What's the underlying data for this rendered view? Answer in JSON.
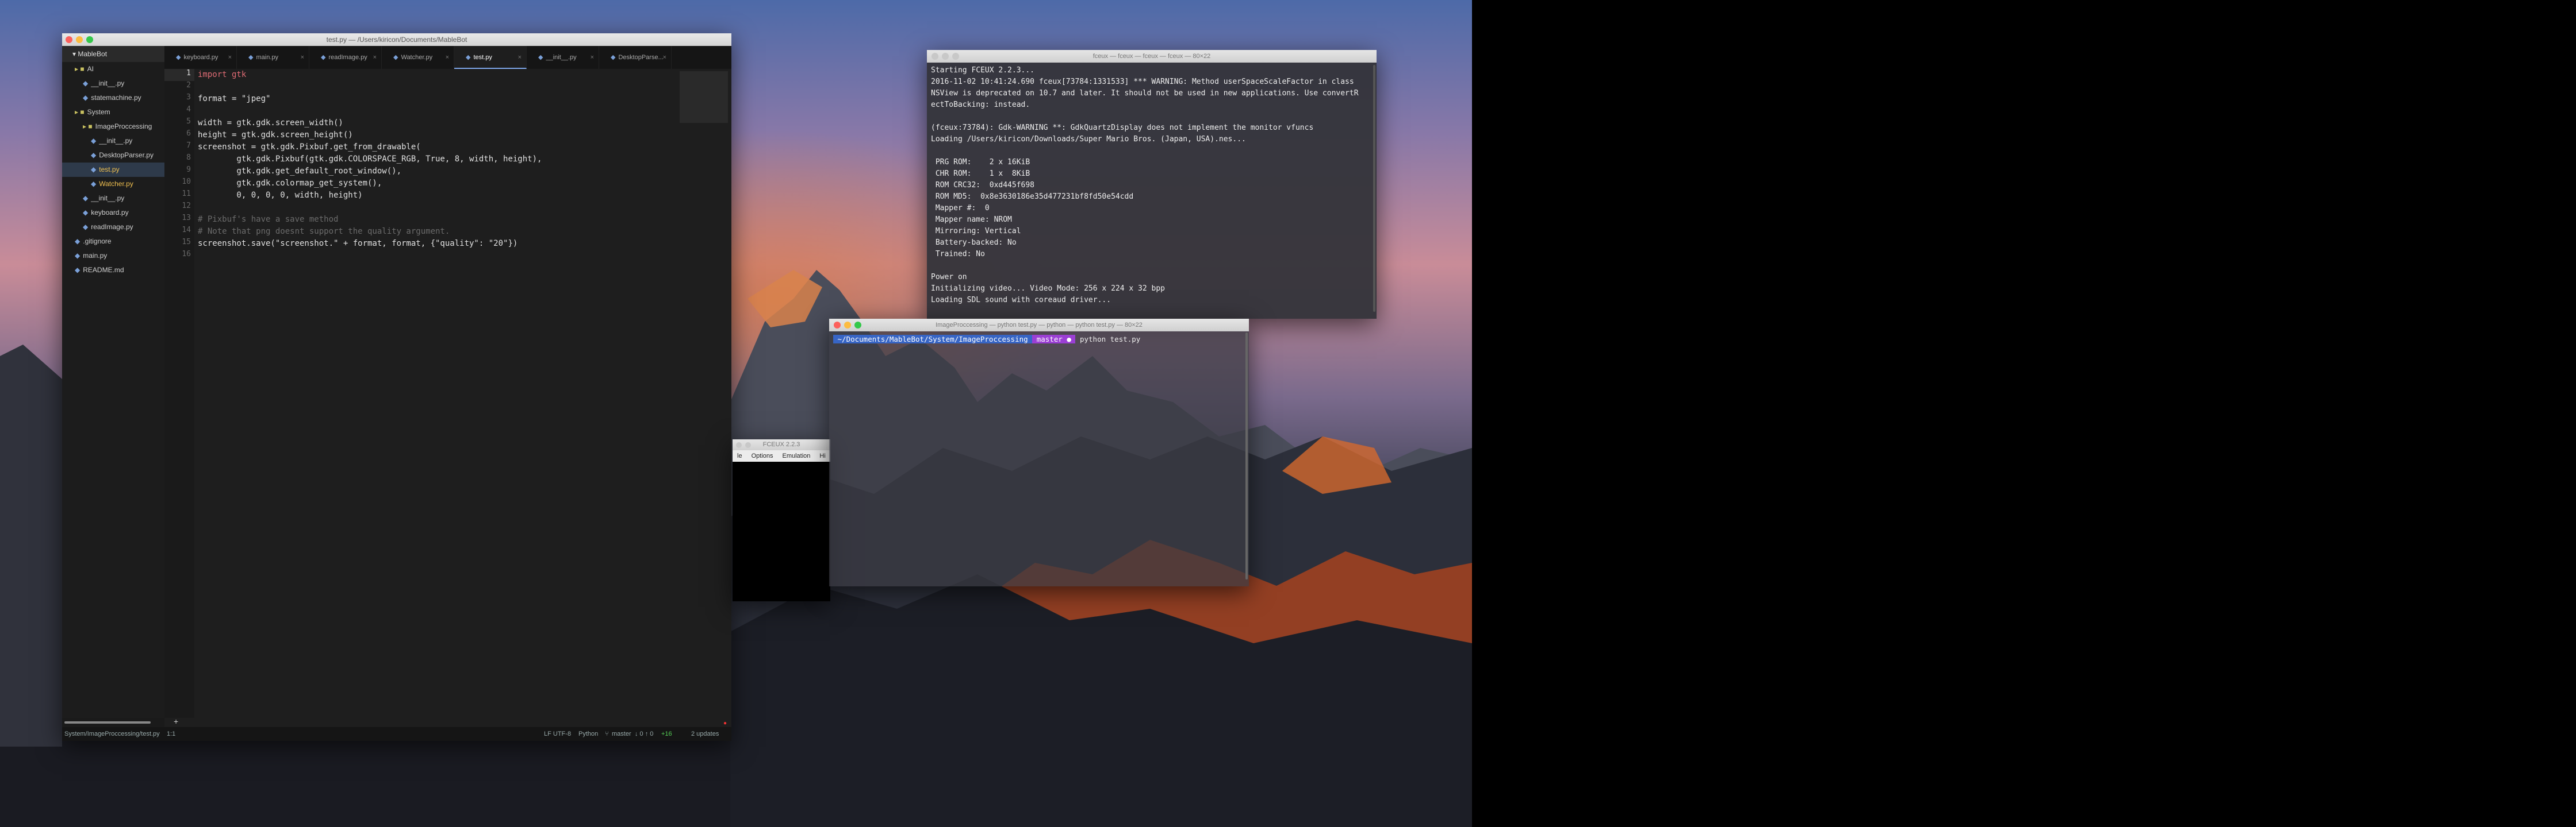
{
  "editor": {
    "title": "test.py — /Users/kiricon/Documents/MableBot",
    "project": "MableBot",
    "tree": [
      {
        "label": "AI",
        "kind": "folder",
        "indent": 1
      },
      {
        "label": "__init__.py",
        "kind": "file",
        "indent": 2
      },
      {
        "label": "statemachine.py",
        "kind": "file",
        "indent": 2
      },
      {
        "label": "System",
        "kind": "folder",
        "indent": 1
      },
      {
        "label": "ImageProccessing",
        "kind": "folder",
        "indent": 2
      },
      {
        "label": "__init__.py",
        "kind": "file",
        "indent": 3
      },
      {
        "label": "DesktopParser.py",
        "kind": "file",
        "indent": 3
      },
      {
        "label": "test.py",
        "kind": "file",
        "indent": 3
      },
      {
        "label": "Watcher.py",
        "kind": "file",
        "indent": 3
      },
      {
        "label": "__init__.py",
        "kind": "file",
        "indent": 2
      },
      {
        "label": "keyboard.py",
        "kind": "file",
        "indent": 2
      },
      {
        "label": "readImage.py",
        "kind": "file",
        "indent": 2
      },
      {
        "label": ".gitignore",
        "kind": "file",
        "indent": 1
      },
      {
        "label": "main.py",
        "kind": "file",
        "indent": 1
      },
      {
        "label": "README.md",
        "kind": "file",
        "indent": 1
      }
    ],
    "tabs": [
      "keyboard.py",
      "main.py",
      "readImage.py",
      "Watcher.py",
      "test.py",
      "__init__.py",
      "DesktopParse..."
    ],
    "active_tab": "test.py",
    "line_numbers": [
      "1",
      "2",
      "3",
      "4",
      "5",
      "6",
      "7",
      "8",
      "9",
      "10",
      "11",
      "12",
      "13",
      "14",
      "15",
      "16"
    ],
    "code": [
      "import gtk",
      "",
      "format = \"jpeg\"",
      "",
      "width = gtk.gdk.screen_width()",
      "height = gtk.gdk.screen_height()",
      "screenshot = gtk.gdk.Pixbuf.get_from_drawable(",
      "        gtk.gdk.Pixbuf(gtk.gdk.COLORSPACE_RGB, True, 8, width, height),",
      "        gtk.gdk.get_default_root_window(),",
      "        gtk.gdk.colormap_get_system(),",
      "        0, 0, 0, 0, width, height)",
      "",
      "# Pixbuf's have a save method",
      "# Note that png doesnt support the quality argument.",
      "screenshot.save(\"screenshot.\" + format, format, {\"quality\": \"20\"})",
      ""
    ],
    "status": {
      "path": "System/ImageProccessing/test.py",
      "cursor": "1:1",
      "encoding": "LF  UTF-8",
      "grammar": "Python",
      "branch": "master",
      "counts": "↓ 0  ↑ 0",
      "diff": "+16",
      "updates": "2 updates"
    }
  },
  "terminal1": {
    "title": "fceux — fceux — fceux — fceux — 80×22",
    "lines": [
      "Starting FCEUX 2.2.3...",
      "2016-11-02 10:41:24.690 fceux[73784:1331533] *** WARNING: Method userSpaceScaleFactor in class",
      "NSView is deprecated on 10.7 and later. It should not be used in new applications. Use convertR",
      "ectToBacking: instead.",
      "",
      "(fceux:73784): Gdk-WARNING **: GdkQuartzDisplay does not implement the monitor vfuncs",
      "Loading /Users/kiricon/Downloads/Super Mario Bros. (Japan, USA).nes...",
      "",
      " PRG ROM:    2 x 16KiB",
      " CHR ROM:    1 x  8KiB",
      " ROM CRC32:  0xd445f698",
      " ROM MD5:  0x8e3630186e35d477231bf8fd50e54cdd",
      " Mapper #:  0",
      " Mapper name: NROM",
      " Mirroring: Vertical",
      " Battery-backed: No",
      " Trained: No",
      "",
      "Power on",
      "Initializing video... Video Mode: 256 x 224 x 32 bpp",
      "Loading SDL sound with coreaud driver..."
    ]
  },
  "terminal2": {
    "title": "ImageProccessing — python test.py — python — python test.py — 80×22",
    "prompt_path": " ~/Documents/MableBot/System/ImageProccessing ",
    "prompt_branch": " master ● ",
    "command": " python test.py"
  },
  "fceux_window": {
    "title": "FCEUX 2.2.3",
    "menu": [
      "le",
      "Options",
      "Emulation",
      "Hi"
    ]
  }
}
